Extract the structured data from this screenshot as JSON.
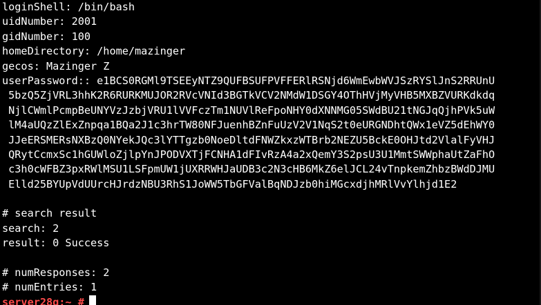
{
  "terminal": {
    "lines": [
      "loginShell: /bin/bash",
      "uidNumber: 2001",
      "gidNumber: 100",
      "homeDirectory: /home/mazinger",
      "gecos: Mazinger Z",
      "userPassword:: e1BCS0RGMl9TSEEyNTZ9QUFBSUFPVFFERlRSNjd6WmEwbWVJSzRYSlJnS2RRUnU",
      " 5bzQ5ZjVRL3hhK2R6RURKMUJOR2RVcVNId3BGTkVCV2NMdW1DSGY4OThHVjMyVHB5MXBZVURKdkdq",
      " NjlCWmlPcmpBeUNYVzJzbjVRU1lVVFczTm1NUVlReFpoNHY0dXNNMG05SWdBU21tNGJqQjhPVk5uW",
      " lM4aUQzZlExZnpqa1BQa2J1c3hrTW80NFJuenhBZnFuUzV2V1NqS2t0eURGNDhtQWx1eVZ5dEhWY0",
      " JJeERSMERsNXBzQ0NYekJQc3lYTTgzb0NoeDltdFNWZkxzWTBrb2NEZU5BckE0OHJtd2VlalFyVHJ",
      " QRytCcmxSc1hGUWloZjlpYnJPODVXTjFCNHA1dFIvRzA4a2xQemY3S2psU3U1MmtSWWphaUtZaFhO",
      " c3h0cWFBZ3pxRWlMSU1LSFpmUW1jUXRRWHJaUDB3c2N3cHB6MkZ6elJCL24vTnpkemZhbzBWdDJMU",
      " Elld25BYUpVdUUrcHJrdzNBU3RhS1JoWW5TbGFValBqNDJzb0hiMGcxdjhMRlVvYlhjd1E2",
      "",
      "# search result",
      "search: 2",
      "result: 0 Success",
      "",
      "# numResponses: 2",
      "# numEntries: 1"
    ],
    "prompt_host": "server28g:~",
    "prompt_symbol": "#",
    "host_color": "#ff4a4a"
  }
}
